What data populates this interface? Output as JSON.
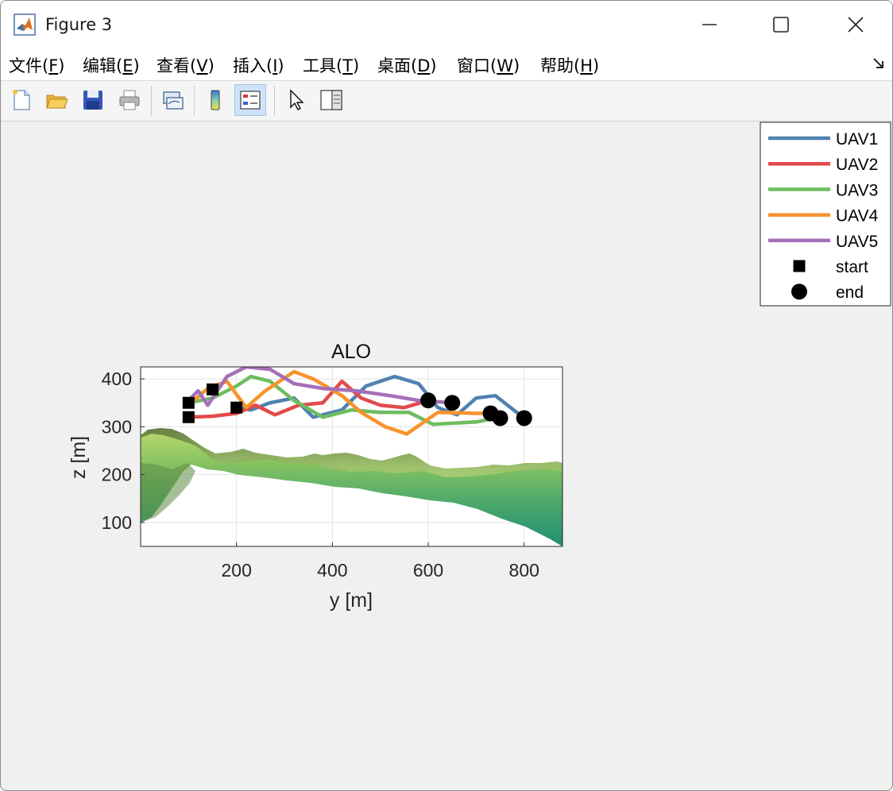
{
  "window": {
    "title": "Figure 3",
    "controls": {
      "minimize": "minimize",
      "maximize": "maximize",
      "close": "close"
    }
  },
  "menu": [
    {
      "label": "文件(",
      "key": "F",
      "tail": ")"
    },
    {
      "label": "编辑(",
      "key": "E",
      "tail": ")"
    },
    {
      "label": "查看(",
      "key": "V",
      "tail": ")"
    },
    {
      "label": "插入(",
      "key": "I",
      "tail": ")"
    },
    {
      "label": "工具(",
      "key": "T",
      "tail": ")"
    },
    {
      "label": "桌面(",
      "key": "D",
      "tail": ")"
    },
    {
      "label": "窗口(",
      "key": "W",
      "tail": ")"
    },
    {
      "label": "帮助(",
      "key": "H",
      "tail": ")"
    }
  ],
  "toolbar": {
    "buttons": [
      "new-figure",
      "open-file",
      "save-figure",
      "print-figure",
      "link-plot",
      "insert-colorbar",
      "insert-legend",
      "edit-plot",
      "property-inspector"
    ]
  },
  "chart_data": {
    "type": "line",
    "title": "ALO",
    "xlabel": "y [m]",
    "ylabel": "z [m]",
    "xlim": [
      0,
      880
    ],
    "ylim": [
      50,
      425
    ],
    "xticks": [
      200,
      400,
      600,
      800
    ],
    "yticks": [
      100,
      200,
      300,
      400
    ],
    "grid": true,
    "legend_position": "outside top-right",
    "series": [
      {
        "name": "UAV1",
        "color": "#4f81b0",
        "x": [
          200,
          230,
          270,
          320,
          360,
          420,
          470,
          530,
          580,
          620,
          660,
          700,
          740,
          800
        ],
        "y": [
          340,
          335,
          350,
          360,
          320,
          335,
          385,
          405,
          390,
          340,
          325,
          360,
          365,
          318
        ]
      },
      {
        "name": "UAV2",
        "color": "#e34a4a",
        "x": [
          100,
          150,
          200,
          240,
          280,
          330,
          380,
          420,
          460,
          500,
          550,
          600
        ],
        "y": [
          320,
          322,
          328,
          345,
          325,
          345,
          350,
          395,
          360,
          345,
          340,
          355
        ]
      },
      {
        "name": "UAV3",
        "color": "#6ebd5f",
        "x": [
          100,
          150,
          200,
          230,
          270,
          320,
          380,
          440,
          500,
          560,
          610,
          700,
          740
        ],
        "y": [
          350,
          360,
          385,
          405,
          395,
          355,
          320,
          335,
          330,
          330,
          305,
          310,
          318
        ]
      },
      {
        "name": "UAV4",
        "color": "#f7932c",
        "x": [
          100,
          140,
          180,
          220,
          260,
          320,
          360,
          420,
          460,
          510,
          555,
          620,
          700,
          740
        ],
        "y": [
          345,
          380,
          395,
          340,
          375,
          415,
          400,
          365,
          330,
          300,
          285,
          330,
          328,
          328
        ]
      },
      {
        "name": "UAV5",
        "color": "#a46fb8",
        "x": [
          100,
          120,
          140,
          180,
          220,
          270,
          320,
          380,
          450,
          520,
          580,
          650
        ],
        "y": [
          355,
          375,
          345,
          405,
          425,
          420,
          390,
          380,
          375,
          365,
          355,
          350
        ]
      }
    ],
    "markers": [
      {
        "name": "start",
        "shape": "square",
        "points": [
          [
            100,
            350
          ],
          [
            100,
            320
          ],
          [
            150,
            378
          ],
          [
            200,
            340
          ]
        ]
      },
      {
        "name": "end",
        "shape": "circle",
        "points": [
          [
            600,
            355
          ],
          [
            650,
            350
          ],
          [
            730,
            328
          ],
          [
            750,
            318
          ],
          [
            800,
            318
          ]
        ]
      }
    ],
    "terrain": {
      "surface_colormap": [
        "#1d8f73",
        "#5bb46b",
        "#9fd36a",
        "#c8d585",
        "#6f8a45"
      ]
    }
  }
}
